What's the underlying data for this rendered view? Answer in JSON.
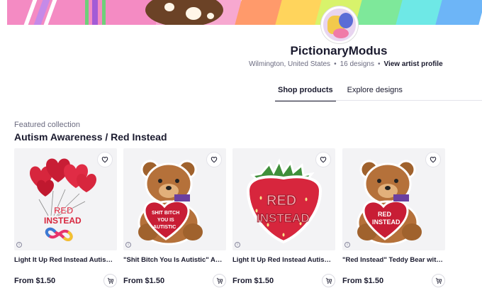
{
  "banner": {
    "stripe_colors": [
      "#ff9a6b",
      "#ffd45c",
      "#d8f36b",
      "#7ee89a",
      "#6ee8e6",
      "#6db5f7"
    ]
  },
  "artist": {
    "name": "PictionaryModus",
    "location": "Wilmington, United States",
    "designs_count": "16 designs",
    "profile_link": "View artist profile"
  },
  "tabs": [
    {
      "label": "Shop products",
      "active": true
    },
    {
      "label": "Explore designs",
      "active": false
    }
  ],
  "collection": {
    "label": "Featured collection",
    "title": "Autism Awareness / Red Instead"
  },
  "products": [
    {
      "title": "Light It Up Red Instead Autism Awareness Sticker",
      "price": "From $1.50",
      "art": "balloons",
      "art_text": [
        "RED",
        "INSTEAD"
      ]
    },
    {
      "title": "\"Shit Bitch You Is Autistic\" Autism Sticker",
      "price": "From $1.50",
      "art": "bear",
      "art_text": [
        "SHIT BITCH",
        "YOU IS",
        "AUTISTIC"
      ]
    },
    {
      "title": "Light It Up Red Instead Autism Awareness Sticker",
      "price": "From $1.50",
      "art": "strawberry",
      "art_text": [
        "RED",
        "INSTEAD"
      ]
    },
    {
      "title": "\"Red Instead\" Teddy Bear with Red Heart Sticker",
      "price": "From $1.50",
      "art": "bear",
      "art_text": [
        "RED",
        "INSTEAD"
      ]
    }
  ],
  "icons": {
    "favorite": "heart-icon",
    "cart": "add-to-cart-icon",
    "info": "info-icon"
  },
  "colors": {
    "text": "#1a1a2e",
    "muted": "#6b6b80",
    "card_bg": "#f3f3f5",
    "accent_red": "#d7263d"
  }
}
